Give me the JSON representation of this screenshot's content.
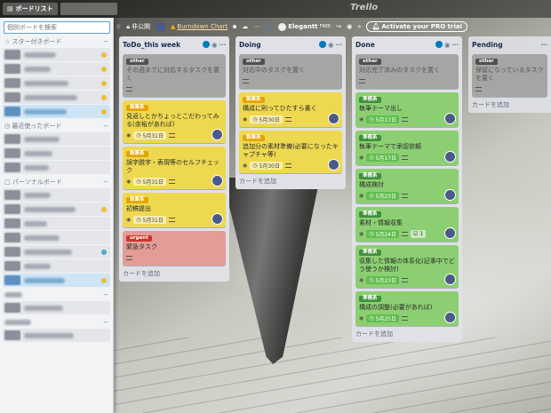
{
  "topbar": {
    "boards_label": "ボードリスト",
    "logo": "Trello"
  },
  "board_header": {
    "visibility": "非公開",
    "powerup": "Burndown Chart",
    "elegantt": "Elegantt",
    "elegantt_sup": "FREE",
    "pro_trial": "Activate your PRO trial"
  },
  "sidebar": {
    "search_placeholder": "個別ボードを検索",
    "sections": {
      "starred": "☆ スター付きボード",
      "recent": "◷ 最近使ったボード",
      "personal": "▢ パーソナルボード"
    }
  },
  "lists": [
    {
      "title": "ToDo_this week",
      "add_card": "カードを追加",
      "cards": [
        {
          "label": "other",
          "title": "その週までに対応するタスクを置く",
          "date": ""
        },
        {
          "label": "執筆系",
          "title": "見返しとかちょっとこだわってみる(余裕があれば)",
          "date": "5月31日"
        },
        {
          "label": "執筆系",
          "title": "誤字脱字・表現等のセルフチェック",
          "date": "5月31日"
        },
        {
          "label": "執筆系",
          "title": "初稿提出",
          "date": "5月31日"
        },
        {
          "label": "urgent",
          "title": "緊急タスク",
          "date": ""
        }
      ]
    },
    {
      "title": "Doing",
      "add_card": "カードを追加",
      "cards": [
        {
          "label": "other",
          "title": "対応中のタスクを置く",
          "date": ""
        },
        {
          "label": "執筆系",
          "title": "構成に則ってひたすら書く",
          "date": "5月30日"
        },
        {
          "label": "執筆系",
          "title": "追加分の素材準備(必要になったキャプチャ等)",
          "date": "5月30日"
        }
      ]
    },
    {
      "title": "Done",
      "add_card": "カードを追加",
      "cards": [
        {
          "label": "other",
          "title": "対応完了済みのタスクを置く",
          "date": ""
        },
        {
          "label": "準備系",
          "title": "執筆テーマ出し",
          "date": "5月17日"
        },
        {
          "label": "準備系",
          "title": "執筆テーマで承認依頼",
          "date": "5月17日"
        },
        {
          "label": "準備系",
          "title": "構成検討",
          "date": "5月23日"
        },
        {
          "label": "準備系",
          "title": "素材・情報収集",
          "date": "5月24日",
          "checklist": "1"
        },
        {
          "label": "準備系",
          "title": "収集した情報の体系化(記事中でどう使うか検討)",
          "date": "5月23日"
        },
        {
          "label": "準備系",
          "title": "構成の調整(必要があれば)",
          "date": "5月25日"
        }
      ]
    },
    {
      "title": "Pending",
      "add_card": "カードを追加",
      "cards": [
        {
          "label": "other",
          "title": "保留になっているタスクを置く",
          "date": ""
        }
      ]
    }
  ]
}
